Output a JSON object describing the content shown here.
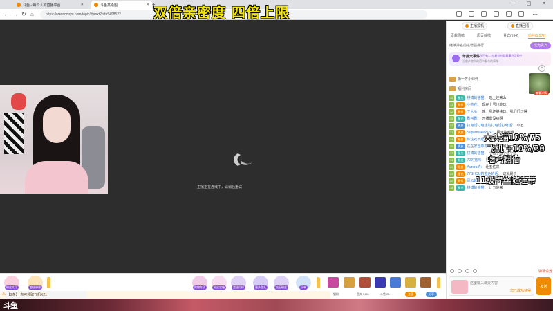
{
  "browser": {
    "tabs": [
      {
        "label": "斗鱼 - 每个人的直播平台",
        "active": false
      },
      {
        "label": "斗鱼高级图",
        "active": true
      }
    ],
    "url": "https://www.douyu.com/topic/dymxt?rid=5498522"
  },
  "overlay": {
    "title": "双倍亲密度  四倍上限",
    "right_lines": [
      "大头猫10%/75",
      "飞机 +10%/30",
      "吃鸡翻倍",
      "11级牌丝随连带"
    ]
  },
  "video": {
    "reconnect_text": "主播正在连线中，请稍后重试"
  },
  "gift_bar": {
    "gifts": [
      {
        "label": "粉丝大厅",
        "color": "#e84a7a"
      },
      {
        "label": "超级弹幕",
        "color": "#f08a00"
      },
      {
        "label": "购物车子",
        "color": "#d04ab8"
      },
      {
        "label": "粉丝宝箱",
        "color": "#e878b8"
      },
      {
        "label": "超级打榜",
        "color": "#8a5ad6"
      },
      {
        "label": "更多鱼丸",
        "color": "#6a4ad6"
      },
      {
        "label": "钻石粉丝",
        "color": "#7a4ad6"
      },
      {
        "label": "下单",
        "color": "#4a8ad6"
      }
    ],
    "items_colors": [
      "#c64aa0",
      "#d6a040",
      "#b0503a",
      "#3a3ab0",
      "#4a7ad6",
      "#d6b040",
      "#a06030"
    ]
  },
  "notice": {
    "text": "【2条】 你可领取飞机X21"
  },
  "info_row": {
    "fans_label": "猫粉",
    "level_label": "鱼丸 5481",
    "count_label": "斗鱼 24",
    "recharge_label": "充值",
    "share_label": "分享"
  },
  "panel": {
    "top_buttons": [
      "主播投机",
      "直播回看"
    ],
    "tabs": [
      "贡献周榜",
      "周贡献榜",
      "贵宾(594)",
      "粉丝(1.9万)"
    ],
    "rank_text": "继续排名前进增强排行",
    "rank_pill": "成为贵宾",
    "event_title": "年度大事件",
    "event_desc": "今日有1.1亿粉丝在超级事件活动中",
    "event_sub": "当前产房内的用户参与的事件",
    "noble_rows": [
      "第一等小伙伴",
      "福利房间"
    ],
    "close_icon": "×",
    "noble_badge": "查看详情"
  },
  "chat": {
    "messages": [
      {
        "lv": "12",
        "fan": "星光",
        "fan_color": "teal",
        "name": "拼搏的猫猫：",
        "text": "晚上还来么"
      },
      {
        "lv": "12",
        "fan": "粉丝",
        "fan_color": "orange",
        "name": "小芸花：",
        "text": "现在上号也能玩"
      },
      {
        "lv": "12",
        "fan": "粉丝",
        "fan_color": "orange",
        "name": "王大头：",
        "text": "晚上我还继续玩，我们们过得"
      },
      {
        "lv": "15",
        "fan": "星光",
        "fan_color": "teal",
        "name": "刷叫刷：",
        "text": "开播晕没啥啊"
      },
      {
        "lv": "22",
        "fan": "贵族",
        "fan_color": "blue",
        "name": "打电话打电话的打电话打电话：",
        "text": "小五"
      },
      {
        "lv": "12",
        "fan": "贵族",
        "fan_color": "orange",
        "name": "Supermake的24：",
        "text": "明天始到谁了"
      },
      {
        "lv": "24",
        "fan": "粉丝",
        "fan_color": "orange",
        "name": "你这吃不起：",
        "text": "嗯"
      },
      {
        "lv": "25",
        "fan": "贵族",
        "fan_color": "blue",
        "name": "在在家里咋办事：",
        "text": "我了最起一个打野"
      },
      {
        "lv": "17",
        "fan": "星光",
        "fan_color": "teal",
        "name": "拼搏的猫猫：",
        "text": "小伍小伍小伍小伍"
      },
      {
        "lv": "13",
        "fan": "粉丝",
        "fan_color": "teal",
        "name": "72的猫咪：",
        "text": "可以就五佐了"
      },
      {
        "lv": "19",
        "fan": "粉丝",
        "fan_color": "orange",
        "name": "Aurora的：",
        "text": "让五佐来"
      },
      {
        "lv": "23",
        "fan": "星光",
        "fan_color": "orange",
        "name": "77SHOU的蓝色的话：",
        "text": "这就是了"
      },
      {
        "lv": "20",
        "fan": "粉丝",
        "fan_color": "orange",
        "name": "风云起：",
        "text": "放噶……来换啊"
      },
      {
        "lv": "16",
        "fan": "星光",
        "fan_color": "teal",
        "name": "拼搏的猫猫：",
        "text": "让五佐来"
      }
    ]
  },
  "input": {
    "placeholder": "这里输入聊天内容",
    "hint": "您已成功获得",
    "send_label": "发送",
    "tool_label": "弹幕设置"
  },
  "bottom_strip": {
    "logo": "斗鱼"
  }
}
